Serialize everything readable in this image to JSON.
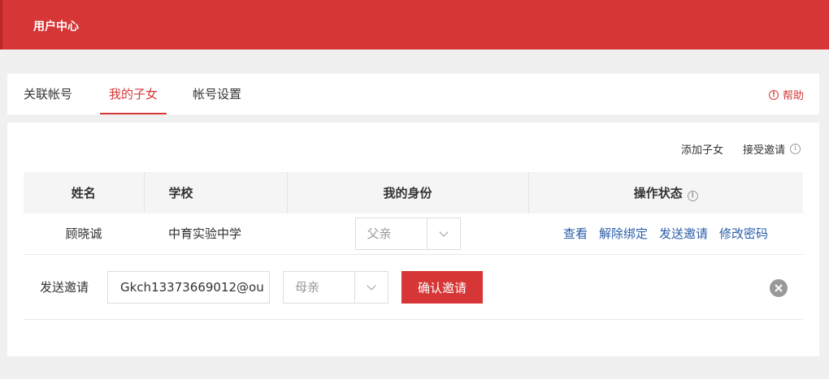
{
  "header": {
    "title": "用户中心"
  },
  "tabs": [
    {
      "label": "关联帐号"
    },
    {
      "label": "我的子女"
    },
    {
      "label": "帐号设置"
    }
  ],
  "help": {
    "label": "帮助",
    "icon": "info-icon"
  },
  "actions": {
    "add_child": "添加子女",
    "accept_invite": "接受邀请"
  },
  "table": {
    "headers": {
      "name": "姓名",
      "school": "学校",
      "role": "我的身份",
      "status": "操作状态"
    },
    "rows": [
      {
        "name": "顾晓诚",
        "school": "中育实验中学",
        "role": "父亲",
        "ops": [
          "查看",
          "解除绑定",
          "发送邀请",
          "修改密码"
        ]
      }
    ]
  },
  "invite": {
    "label": "发送邀请",
    "email_value": "Gkch13373669012@ou",
    "role_value": "母亲",
    "confirm_label": "确认邀请"
  },
  "colors": {
    "brand": "#d63636",
    "link": "#2a5ea8"
  }
}
